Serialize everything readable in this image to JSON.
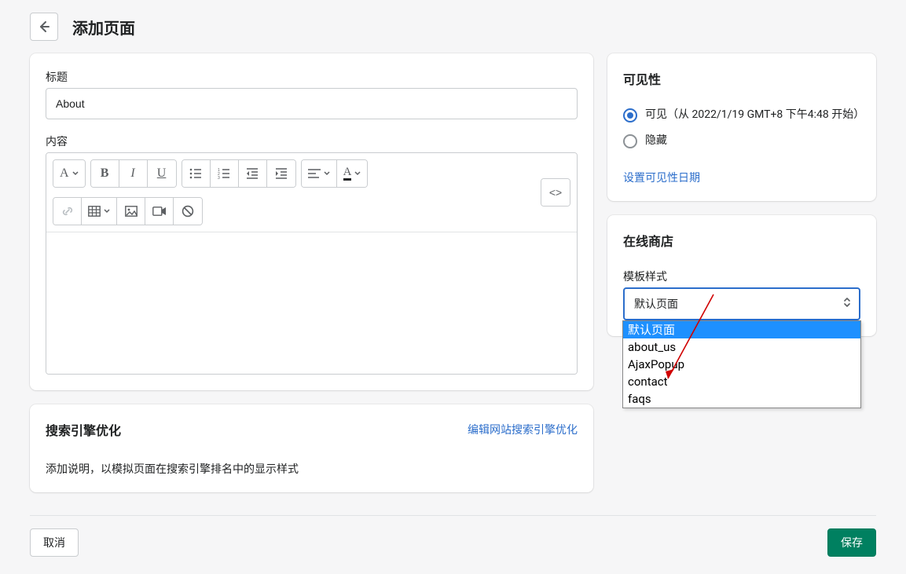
{
  "header": {
    "title": "添加页面"
  },
  "main": {
    "title_label": "标题",
    "title_value": "About",
    "content_label": "内容"
  },
  "seo": {
    "title": "搜索引擎优化",
    "edit_link": "编辑网站搜索引擎优化",
    "description": "添加说明，以模拟页面在搜索引擎排名中的显示样式"
  },
  "visibility": {
    "title": "可见性",
    "visible_label": "可见（从 2022/1/19 GMT+8 下午4:48 开始）",
    "hidden_label": "隐藏",
    "date_link": "设置可见性日期"
  },
  "online_store": {
    "title": "在线商店",
    "template_label": "模板样式",
    "selected": "默认页面",
    "options": [
      "默认页面",
      "about_us",
      "AjaxPopup",
      "contact",
      "faqs"
    ]
  },
  "footer": {
    "cancel": "取消",
    "save": "保存"
  },
  "toolbar_text": {
    "a": "A",
    "b": "B",
    "i": "I",
    "u": "U",
    "a2": "A",
    "code": "<>"
  }
}
